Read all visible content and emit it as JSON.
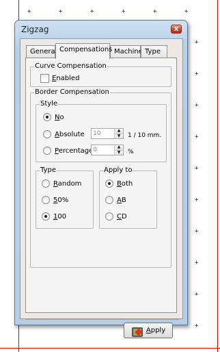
{
  "window": {
    "title": "Zigzag",
    "close_glyph": "x"
  },
  "tabs": [
    {
      "label": "General",
      "active": false
    },
    {
      "label": "Compensations",
      "active": true
    },
    {
      "label": "Machine",
      "active": false
    },
    {
      "label": "Type",
      "active": false
    }
  ],
  "curve": {
    "legend": "Curve Compensation",
    "enabled_label": "Enabled",
    "enabled": false
  },
  "border": {
    "legend": "Border Compensation",
    "style": {
      "legend": "Style",
      "no_label": "No",
      "absolute_label": "Absolute",
      "absolute_value": "10",
      "absolute_unit": "1 / 10 mm.",
      "percentage_label": "Percentage",
      "percentage_value": "0",
      "percentage_unit": "%",
      "selected": "No"
    },
    "type": {
      "legend": "Type",
      "options": [
        "Random",
        "50%",
        "100"
      ],
      "selected": "100"
    },
    "apply_to": {
      "legend": "Apply to",
      "options": [
        "Both",
        "AB",
        "CD"
      ],
      "selected": "Both"
    }
  },
  "apply_button": {
    "label": "Apply",
    "icon": "tool-icon"
  },
  "colors": {
    "accent_red": "#e00000",
    "title_bar": "#b9cfe8",
    "close": "#c9452b"
  }
}
